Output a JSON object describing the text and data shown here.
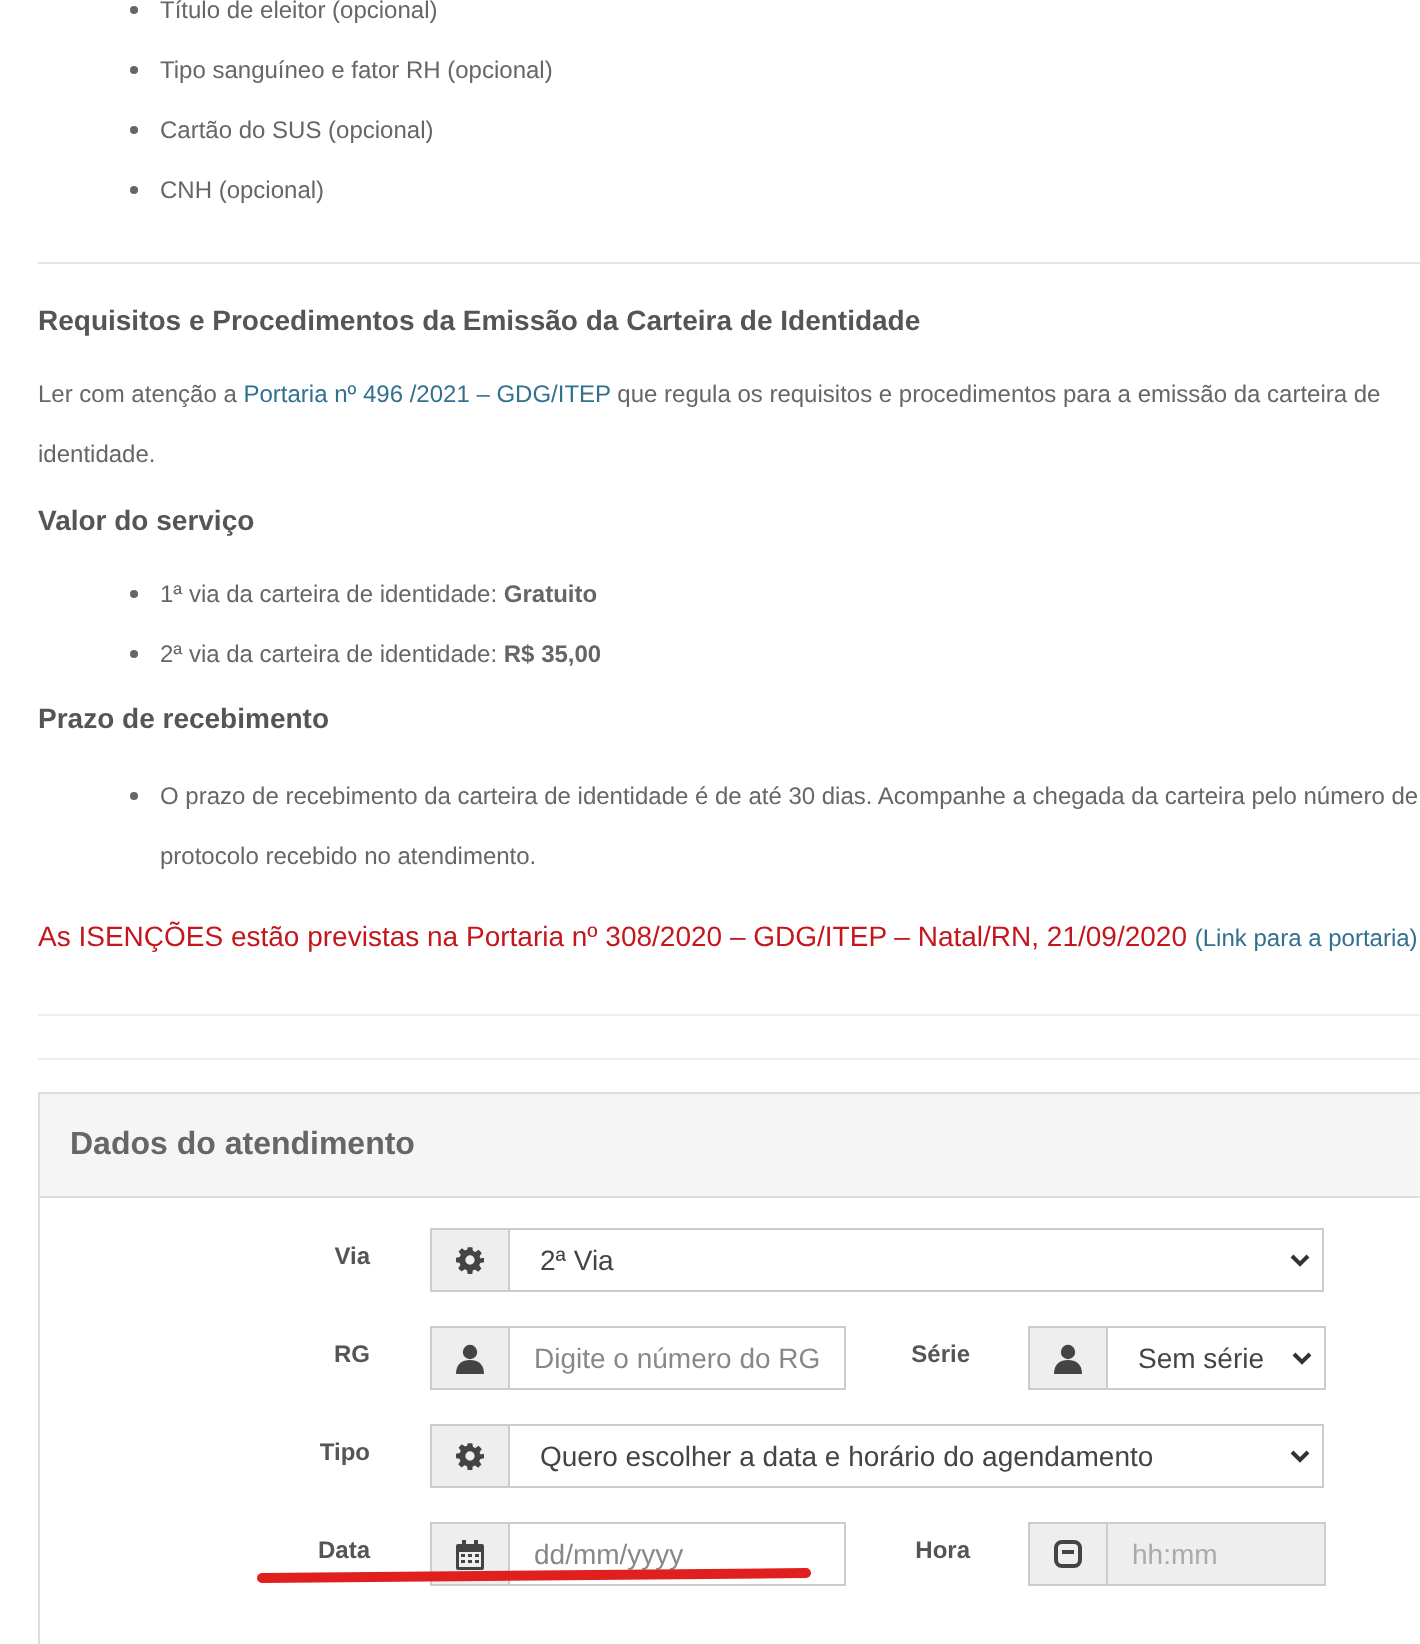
{
  "documents_list": [
    "Título de eleitor (opcional)",
    "Tipo sanguíneo e fator RH (opcional)",
    "Cartão do SUS (opcional)",
    "CNH (opcional)"
  ],
  "requirements": {
    "title": "Requisitos e Procedimentos da Emissão da Carteira de Identidade",
    "text_before": "Ler com atenção a",
    "link": "Portaria nº 496 /2021 – GDG/ITEP",
    "text_after": "que regula os requisitos e procedimentos para a emissão da carteira de identidade."
  },
  "price": {
    "title": "Valor do serviço",
    "items": [
      "1ª via da carteira de identidade: **Gratuito**",
      "2ª via da carteira de identidade: **R$ 35,00**"
    ]
  },
  "deadline": {
    "title": "Prazo de recebimento",
    "items": [
      "O prazo de recebimento da carteira de identidade é de até 30 dias. Acompanhe a chegada da carteira pelo número de protocolo recebido no atendimento."
    ]
  },
  "exemption": {
    "text": "As ISENÇÕES estão previstas na Portaria nº 308/2020 – GDG/ITEP – Natal/RN, 21/09/2020",
    "link": "(Link para a portaria)"
  },
  "form": {
    "title": "Dados do atendimento",
    "rows": [
      [
        {
          "label": "Via",
          "kind": "select",
          "value": "2ª Via",
          "disabled": false
        }
      ],
      [
        {
          "label": "RG",
          "kind": "input",
          "placeholder": "Digite o número do RG",
          "disabled": false
        },
        {
          "label": "Série",
          "kind": "select",
          "value": "Sem série",
          "disabled": false
        }
      ],
      [
        {
          "label": "Tipo",
          "kind": "select",
          "value": "Quero escolher a data e horário do agendamento",
          "disabled": false
        }
      ],
      [
        {
          "label": "Data",
          "kind": "input",
          "placeholder": "dd/mm/yyyy",
          "disabled": false
        },
        {
          "label": "Hora",
          "kind": "input",
          "placeholder": "hh:mm",
          "disabled": true
        }
      ]
    ]
  }
}
